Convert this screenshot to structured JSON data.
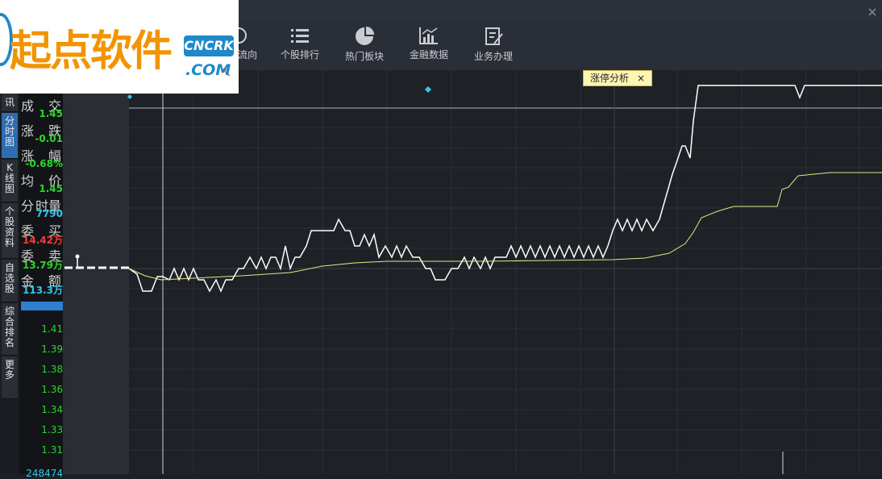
{
  "toolbar": {
    "items": [
      {
        "label": "资金流向",
        "icon": "flow-icon"
      },
      {
        "label": "个股排行",
        "icon": "list-icon"
      },
      {
        "label": "热门板块",
        "icon": "pie-icon"
      },
      {
        "label": "金融数据",
        "icon": "bar-chart-icon"
      },
      {
        "label": "业务办理",
        "icon": "edit-doc-icon"
      }
    ],
    "visible_partial_label": "流向"
  },
  "logo": {
    "text": "起点软件",
    "badge": "CNCRK",
    "domain": ".COM"
  },
  "tag": {
    "label": "涨停分析",
    "close": "×"
  },
  "side_tabs": [
    "讯",
    "分时图",
    "K线图",
    "个股资料",
    "自选股",
    "综合排名",
    "更多"
  ],
  "info": {
    "rows": [
      {
        "l": "成",
        "r": "交",
        "value": "1.45",
        "color": "#2bd62b"
      },
      {
        "l": "涨",
        "r": "跌",
        "value": "-0.01",
        "color": "#2bd62b"
      },
      {
        "l": "涨",
        "r": "幅",
        "value": "-0.68%",
        "color": "#2bd62b"
      },
      {
        "l": "均",
        "r": "价",
        "value": "1.45",
        "color": "#2bd62b"
      },
      {
        "l": "分",
        "r": "时量",
        "value": "7790",
        "color": "#33c8e8"
      },
      {
        "l": "委",
        "r": "买",
        "value": "14.42万",
        "color": "#ff3b30"
      },
      {
        "l": "委",
        "r": "卖",
        "value": "13.79万",
        "color": "#2bd62b"
      },
      {
        "l": "金",
        "r": "额",
        "value": "113.3万",
        "color": "#33c8e8"
      }
    ]
  },
  "price_axis": [
    "1.41",
    "1.39",
    "1.38",
    "1.36",
    "1.34",
    "1.33",
    "1.31"
  ],
  "volume_axis_label": "248474",
  "colors": {
    "price_line": "#ffffff",
    "avg_line": "#e6e68a",
    "up": "#ff3b30",
    "down": "#2bd62b",
    "accent": "#2d6db0"
  }
}
